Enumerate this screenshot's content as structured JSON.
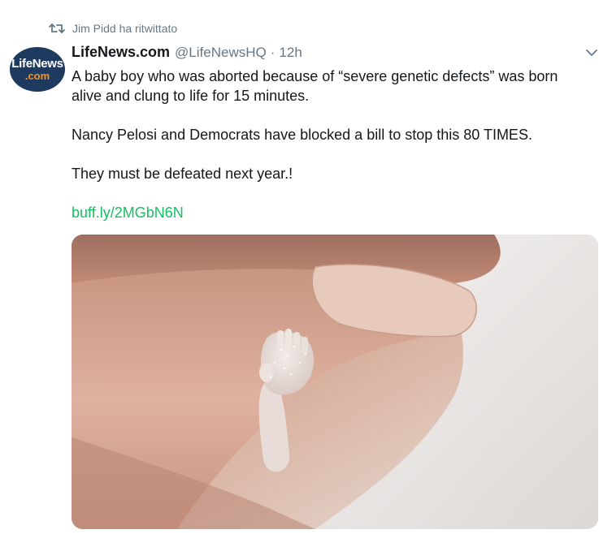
{
  "social_context": {
    "icon": "retweet-icon",
    "text": "Jim Pidd ha ritwittato"
  },
  "tweet": {
    "avatar": {
      "logo_top": "LifeNews",
      "logo_bottom": ".com",
      "brand_colors": {
        "background": "#1e3a5f",
        "text": "#ffffff",
        "accent": "#f7941d"
      }
    },
    "author_name": "LifeNews.com",
    "handle": "@LifeNewsHQ",
    "separator": "·",
    "timestamp": "12h",
    "menu_icon": "chevron-down-icon",
    "paragraphs": [
      "A baby boy who was aborted because of “severe genetic defects” was born alive and clung to life for 15 minutes.",
      "Nancy Pelosi and Democrats have blocked a bill to stop this 80 TIMES.",
      "They must be defeated next year.!"
    ],
    "link_text": "buff.ly/2MGbN6N",
    "colors": {
      "link": "#17bf63",
      "secondary_text": "#657786",
      "primary_text": "#14171a"
    }
  }
}
